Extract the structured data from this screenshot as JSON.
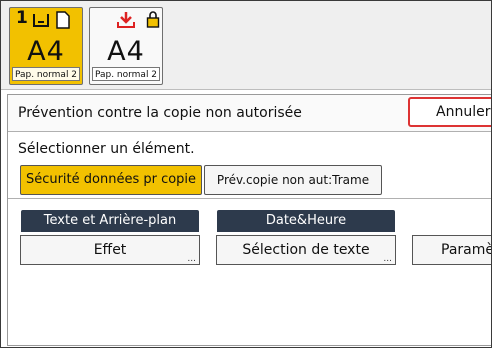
{
  "trays": [
    {
      "tray_number": "1",
      "size": "A4",
      "paper": "Pap. normal 2",
      "selected": true
    },
    {
      "size": "A4",
      "paper": "Pap. normal 2",
      "selected": false
    }
  ],
  "panel": {
    "title": "Prévention contre la copie non autorisée",
    "cancel_label": "Annuler",
    "select_label": "Sélectionner un élément.",
    "options": [
      {
        "label": "Sécurité données pr copie",
        "selected": true
      },
      {
        "label": "Prév.copie non aut:Trame",
        "selected": false
      }
    ],
    "groups": [
      {
        "header": "Texte et Arrière-plan",
        "button": "Effet"
      },
      {
        "header": "Date&Heure",
        "button": "Sélection de texte"
      },
      {
        "button": "Paramè"
      }
    ],
    "more": "..."
  },
  "colors": {
    "accent": "#f2c100",
    "header_bg": "#2d3a4c",
    "cancel_border": "#dd3333",
    "download_icon": "#dd2222"
  }
}
